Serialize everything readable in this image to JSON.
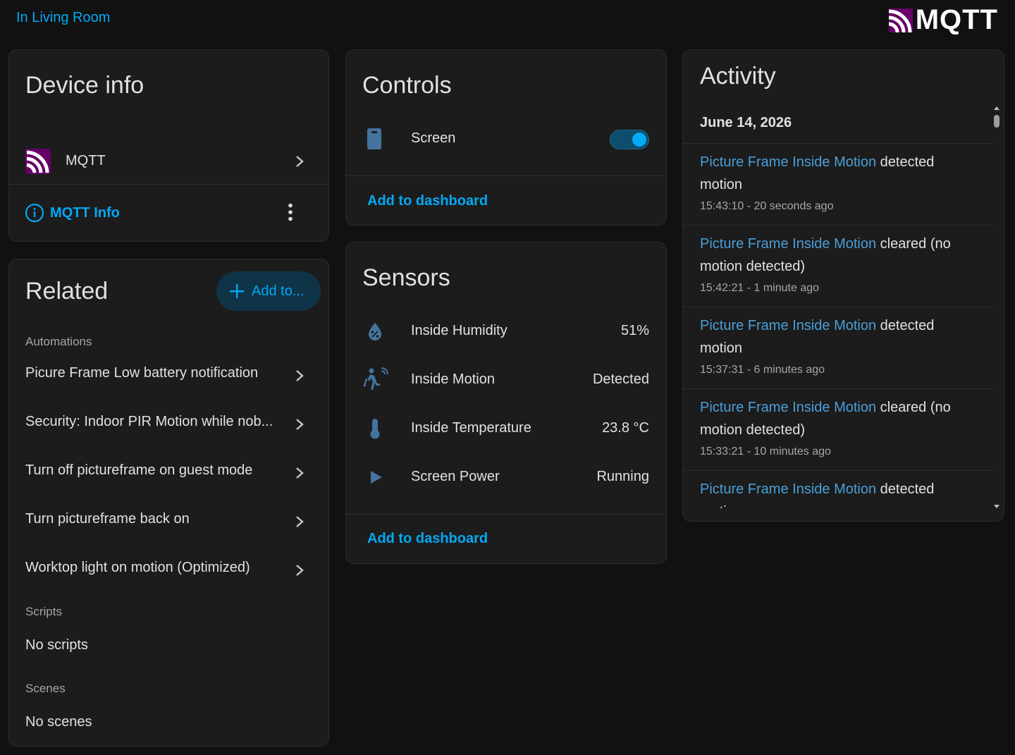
{
  "header": {
    "area_link": "In Living Room",
    "logo_text": "MQTT",
    "colors": {
      "accent": "#03a9f4",
      "mqtt_purple": "#660066"
    }
  },
  "device_info": {
    "title": "Device info",
    "integration": {
      "label": "MQTT",
      "icon": "mqtt-logo-icon"
    },
    "info_button": {
      "label": "MQTT Info",
      "icon": "info-circle-icon"
    },
    "menu_icon": "dots-vertical-icon"
  },
  "related": {
    "title": "Related",
    "add_button": "Add to...",
    "automations_label": "Automations",
    "automations": [
      "Picure Frame Low battery notification",
      "Security: Indoor PIR Motion while nob...",
      "Turn off pictureframe on guest mode",
      "Turn pictureframe back on",
      "Worktop light on motion (Optimized)"
    ],
    "scripts_label": "Scripts",
    "scripts_empty": "No scripts",
    "scenes_label": "Scenes",
    "scenes_empty": "No scenes"
  },
  "controls": {
    "title": "Controls",
    "items": [
      {
        "label": "Screen",
        "icon": "tablet-icon",
        "state": "on"
      }
    ],
    "add_to_dashboard": "Add to dashboard"
  },
  "sensors": {
    "title": "Sensors",
    "items": [
      {
        "label": "Inside Humidity",
        "value": "51%",
        "icon": "water-percent-icon"
      },
      {
        "label": "Inside Motion",
        "value": "Detected",
        "icon": "motion-sensor-icon"
      },
      {
        "label": "Inside Temperature",
        "value": "23.8 °C",
        "icon": "thermometer-icon"
      },
      {
        "label": "Screen Power",
        "value": "Running",
        "icon": "play-icon"
      }
    ],
    "add_to_dashboard": "Add to dashboard"
  },
  "activity": {
    "title": "Activity",
    "date": "June 14, 2026",
    "entries": [
      {
        "entity": "Picture Frame Inside Motion",
        "message": " detected motion",
        "time": "15:43:10 - 20 seconds ago"
      },
      {
        "entity": "Picture Frame Inside Motion",
        "message": " cleared (no motion detected)",
        "time": "15:42:21 - 1 minute ago"
      },
      {
        "entity": "Picture Frame Inside Motion",
        "message": " detected motion",
        "time": "15:37:31 - 6 minutes ago"
      },
      {
        "entity": "Picture Frame Inside Motion",
        "message": " cleared (no motion detected)",
        "time": "15:33:21 - 10 minutes ago"
      },
      {
        "entity": "Picture Frame Inside Motion",
        "message": " detected motion",
        "time": ""
      }
    ]
  }
}
